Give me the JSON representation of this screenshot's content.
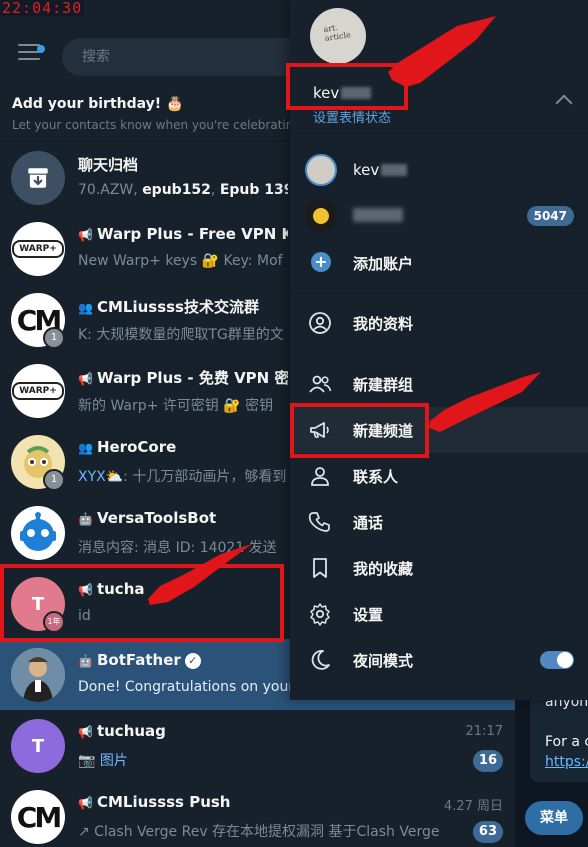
{
  "clock": "22:04:30",
  "search": {
    "placeholder": "搜索"
  },
  "birthday": {
    "title": "Add your birthday! 🎂",
    "subtitle": "Let your contacts know when you're celebrating"
  },
  "chats": [
    {
      "name": "聊天归档",
      "preview_parts": [
        "70.AZW, ",
        "epub152",
        ", ",
        "Epub 139",
        ", "
      ],
      "time": "",
      "count": ""
    },
    {
      "name": "Warp Plus - Free VPN Keys",
      "preview": "New Warp+ keys 🔐 Key: Mof",
      "time": "",
      "count": ""
    },
    {
      "name": "CMLiussss技术交流群",
      "preview": "K: 大规模数量的爬取TG群里的文",
      "badge": "1",
      "time": "",
      "count": ""
    },
    {
      "name": "Warp Plus - 免费 VPN 密钥",
      "preview": "新的 Warp+ 许可密钥 🔐 密钥",
      "time": "",
      "count": ""
    },
    {
      "name": "HeroCore",
      "preview_sender": "XYX",
      "preview": "⛅: 十几万部动画片，够看到",
      "badge": "1",
      "time": "",
      "count": ""
    },
    {
      "name": "VersaToolsBot",
      "preview": "消息内容: 消息 ID: 14021 发送",
      "time": "",
      "count": ""
    },
    {
      "name": "tucha",
      "avatar_letter": "T",
      "preview": "id",
      "badge": "1年",
      "time": "",
      "count": ""
    },
    {
      "name": "BotFather",
      "preview": "Done! Congratulations on your",
      "time": "",
      "count": ""
    },
    {
      "name": "tuchuag",
      "avatar_letter": "T",
      "preview": "📷 图片",
      "time": "21:17",
      "count": "16"
    },
    {
      "name": "CMLiussss Push",
      "preview": "↗ Clash Verge Rev 存在本地提权漏洞  基于Clash Verge",
      "time": "4.27 周日",
      "count": "63"
    }
  ],
  "chat_panel": {
    "bubble_lines": [
      "anyon",
      "For a c",
      "https:/"
    ],
    "menu_button": "菜单"
  },
  "drawer": {
    "avatar_note": "art. article",
    "name": "kev",
    "status": "设置表情状态",
    "accounts": [
      {
        "name": "kev",
        "badge": ""
      },
      {
        "name": "",
        "badge": "5047"
      }
    ],
    "add_account": "添加账户",
    "items": [
      {
        "icon": "profile-icon",
        "label": "我的资料"
      },
      {
        "icon": "group-icon",
        "label": "新建群组"
      },
      {
        "icon": "megaphone-icon",
        "label": "新建频道"
      },
      {
        "icon": "contact-icon",
        "label": "联系人"
      },
      {
        "icon": "phone-icon",
        "label": "通话"
      },
      {
        "icon": "bookmark-icon",
        "label": "我的收藏"
      },
      {
        "icon": "gear-icon",
        "label": "设置"
      },
      {
        "icon": "moon-icon",
        "label": "夜间模式"
      }
    ],
    "night_mode_on": true
  },
  "colors": {
    "background": "#17212b",
    "accent": "#5288c1",
    "active_row": "#2b5278",
    "annotation_red": "#e0161b"
  }
}
